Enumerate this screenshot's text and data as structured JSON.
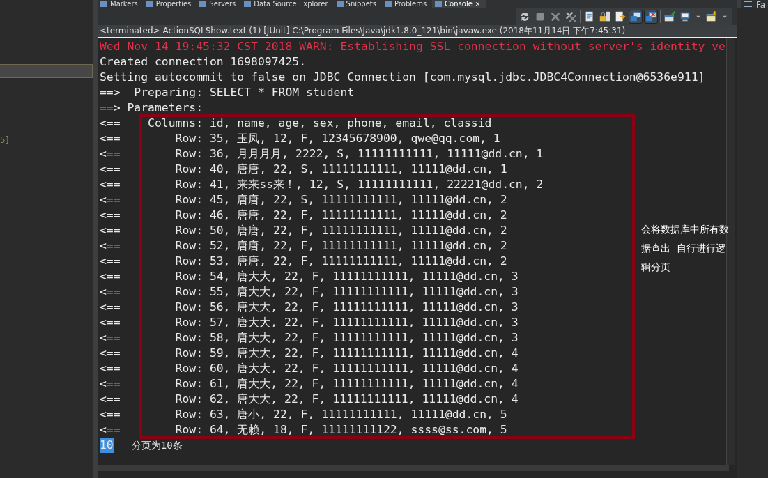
{
  "tabs": [
    {
      "label": "Markers",
      "selected": false
    },
    {
      "label": "Properties",
      "selected": false
    },
    {
      "label": "Servers",
      "selected": false
    },
    {
      "label": "Data Source Explorer",
      "selected": false
    },
    {
      "label": "Snippets",
      "selected": false
    },
    {
      "label": "Problems",
      "selected": false
    },
    {
      "label": "Console",
      "selected": true,
      "close": "✕"
    }
  ],
  "left_panel": {
    "fragment": "5]"
  },
  "right_panel": {
    "label": "Fa"
  },
  "status": "<terminated> ActionSQLShow.text (1) [JUnit] C:\\Program Files\\Java\\jdk1.8.0_121\\bin\\javaw.exe (2018年11月14日 下午7:45:31)",
  "console_lines": [
    {
      "kind": "warn",
      "text": "Wed Nov 14 19:45:32 CST 2018 WARN: Establishing SSL connection without server's identity ve"
    },
    {
      "kind": "info",
      "text": "Created connection 1698097425."
    },
    {
      "kind": "info",
      "text": "Setting autocommit to false on JDBC Connection [com.mysql.jdbc.JDBC4Connection@6536e911]"
    },
    {
      "kind": "info",
      "text": "==>  Preparing: SELECT * FROM student"
    },
    {
      "kind": "info",
      "text": "==> Parameters: "
    },
    {
      "kind": "info",
      "text": "<==    Columns: id, name, age, sex, phone, email, classid"
    },
    {
      "kind": "info",
      "text": "<==        Row: 35, 玉凤, 12, F, 12345678900, qwe@qq.com, 1"
    },
    {
      "kind": "info",
      "text": "<==        Row: 36, 月月月月, 2222, S, 11111111111, 11111@dd.cn, 1"
    },
    {
      "kind": "info",
      "text": "<==        Row: 40, 唐唐, 22, S, 11111111111, 11111@dd.cn, 1"
    },
    {
      "kind": "info",
      "text": "<==        Row: 41, 来来ss来！, 12, S, 11111111111, 22221@dd.cn, 2"
    },
    {
      "kind": "info",
      "text": "<==        Row: 45, 唐唐, 22, S, 11111111111, 11111@dd.cn, 2"
    },
    {
      "kind": "info",
      "text": "<==        Row: 46, 唐唐, 22, F, 11111111111, 11111@dd.cn, 2"
    },
    {
      "kind": "info",
      "text": "<==        Row: 50, 唐唐, 22, F, 11111111111, 11111@dd.cn, 2"
    },
    {
      "kind": "info",
      "text": "<==        Row: 52, 唐唐, 22, F, 11111111111, 11111@dd.cn, 2"
    },
    {
      "kind": "info",
      "text": "<==        Row: 53, 唐唐, 22, F, 11111111111, 11111@dd.cn, 2"
    },
    {
      "kind": "info",
      "text": "<==        Row: 54, 唐大大, 22, F, 11111111111, 11111@dd.cn, 3"
    },
    {
      "kind": "info",
      "text": "<==        Row: 55, 唐大大, 22, F, 11111111111, 11111@dd.cn, 3"
    },
    {
      "kind": "info",
      "text": "<==        Row: 56, 唐大大, 22, F, 11111111111, 11111@dd.cn, 3"
    },
    {
      "kind": "info",
      "text": "<==        Row: 57, 唐大大, 22, F, 11111111111, 11111@dd.cn, 3"
    },
    {
      "kind": "info",
      "text": "<==        Row: 58, 唐大大, 22, F, 11111111111, 11111@dd.cn, 3"
    },
    {
      "kind": "info",
      "text": "<==        Row: 59, 唐大大, 22, F, 11111111111, 11111@dd.cn, 4"
    },
    {
      "kind": "info",
      "text": "<==        Row: 60, 唐大大, 22, F, 11111111111, 11111@dd.cn, 4"
    },
    {
      "kind": "info",
      "text": "<==        Row: 61, 唐大大, 22, F, 11111111111, 11111@dd.cn, 4"
    },
    {
      "kind": "info",
      "text": "<==        Row: 62, 唐大大, 22, F, 11111111111, 11111@dd.cn, 4"
    },
    {
      "kind": "info",
      "text": "<==        Row: 63, 唐小, 22, F, 11111111111, 11111@dd.cn, 5"
    },
    {
      "kind": "info",
      "text": "<==        Row: 64, 无赖, 18, F, 11111111122, ssss@ss.com, 5"
    }
  ],
  "input_line": {
    "selected_text": "10",
    "note": "分页为10条"
  },
  "annotation": "会将数据库中所有数据查出  自行进行逻辑分页"
}
